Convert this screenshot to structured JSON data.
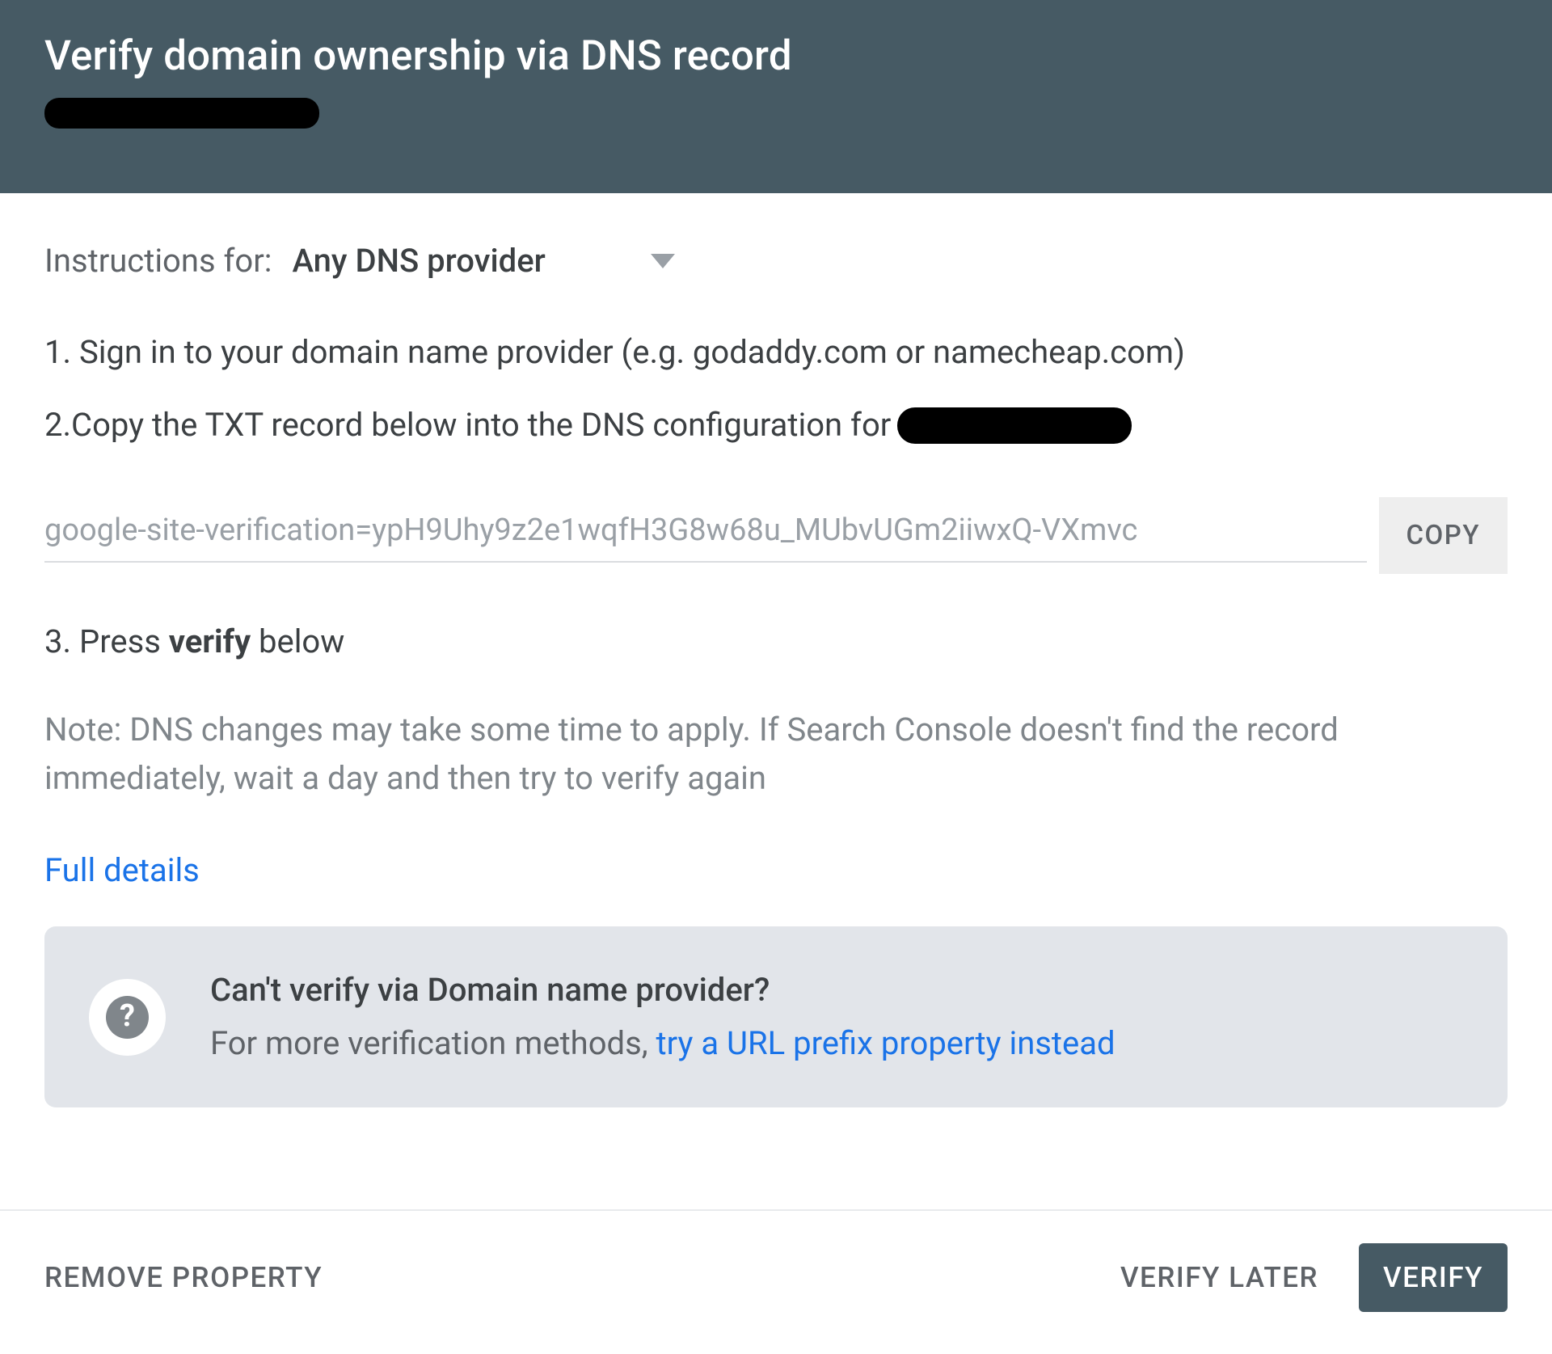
{
  "header": {
    "title": "Verify domain ownership via DNS record"
  },
  "instructions": {
    "label": "Instructions for:",
    "providerSelected": "Any DNS provider"
  },
  "steps": {
    "s1_prefix": "1. ",
    "s1_text": "Sign in to your domain name provider (e.g. godaddy.com or namecheap.com)",
    "s2_prefix": "2. ",
    "s2_text": "Copy the TXT record below into the DNS configuration for",
    "s3_prefix": "3. ",
    "s3_a": "Press ",
    "s3_bold": "verify",
    "s3_b": " below"
  },
  "txt": {
    "value": "google-site-verification=ypH9Uhy9z2e1wqfH3G8w68u_MUbvUGm2iiwxQ-VXmvc",
    "copyLabel": "COPY"
  },
  "note": "Note: DNS changes may take some time to apply. If Search Console doesn't find the record immediately, wait a day and then try to verify again",
  "detailsLink": "Full details",
  "infoCard": {
    "title": "Can't verify via Domain name provider?",
    "body": "For more verification methods, ",
    "link": "try a URL prefix property instead"
  },
  "footer": {
    "remove": "REMOVE PROPERTY",
    "later": "VERIFY LATER",
    "verify": "VERIFY"
  }
}
